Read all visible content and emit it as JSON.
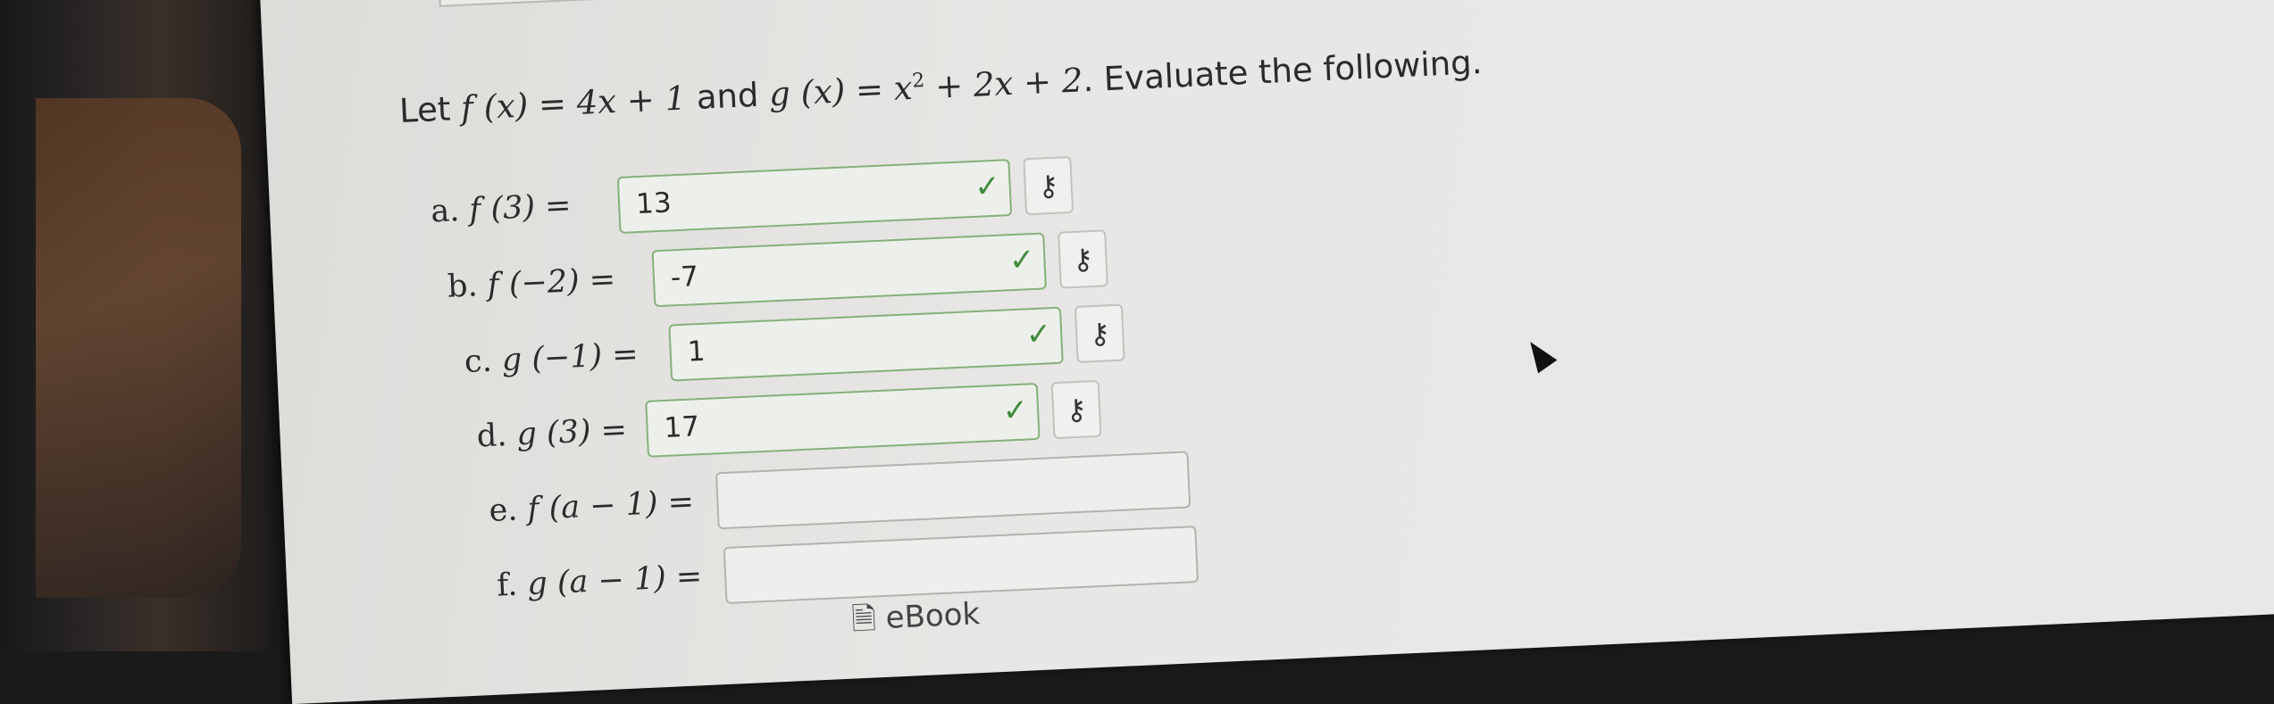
{
  "problem": {
    "prefix": "Let ",
    "f_def": "f (x) = 4x + 1",
    "and_word": " and ",
    "g_def_a": "g (x) = x",
    "g_def_exp": "2",
    "g_def_b": " + 2x + 2",
    "suffix": ". Evaluate the following."
  },
  "parts": [
    {
      "letter": "a.",
      "expr": "f (3) =",
      "value": "13",
      "correct": true
    },
    {
      "letter": "b.",
      "expr": "f (−2) =",
      "value": "-7",
      "correct": true
    },
    {
      "letter": "c.",
      "expr": "g (−1) =",
      "value": "1",
      "correct": true
    },
    {
      "letter": "d.",
      "expr": "g (3) =",
      "value": "17",
      "correct": true
    },
    {
      "letter": "e.",
      "expr": "f (a − 1) =",
      "value": "",
      "correct": false
    },
    {
      "letter": "f.",
      "expr": "g (a − 1) =",
      "value": "",
      "correct": false
    }
  ],
  "icons": {
    "check": "check-icon",
    "key": "key-icon"
  },
  "footer": {
    "ebook_label": "eBook"
  },
  "colors": {
    "correct_border": "#86b07b",
    "check": "#3e8a3b"
  }
}
